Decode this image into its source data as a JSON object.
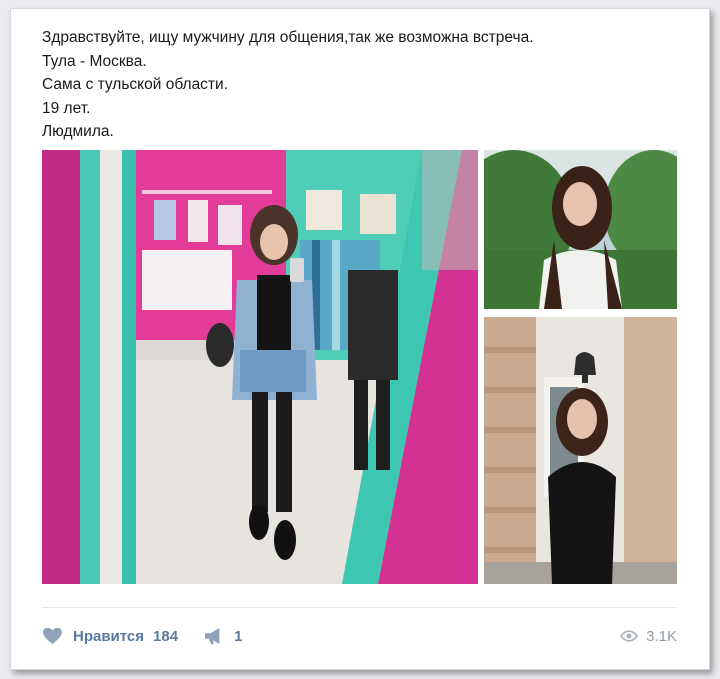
{
  "post": {
    "lines": [
      "Здравствуйте, ищу мужчину для общения,так же возможна встреча.",
      "Тула - Москва.",
      "Сама с тульской области.",
      "19 лет.",
      "Людмила."
    ]
  },
  "photos": [
    {
      "icon": "mirror-selfie-photo"
    },
    {
      "icon": "portrait-photo"
    },
    {
      "icon": "street-photo"
    }
  ],
  "actions": {
    "like_label": "Нравится",
    "like_count": "184",
    "share_count": "1",
    "views_count": "3.1K"
  },
  "colors": {
    "accent": "#5a7aa0",
    "muted": "#939ba5",
    "magenta": "#d6288a",
    "teal": "#3ec9b8"
  }
}
